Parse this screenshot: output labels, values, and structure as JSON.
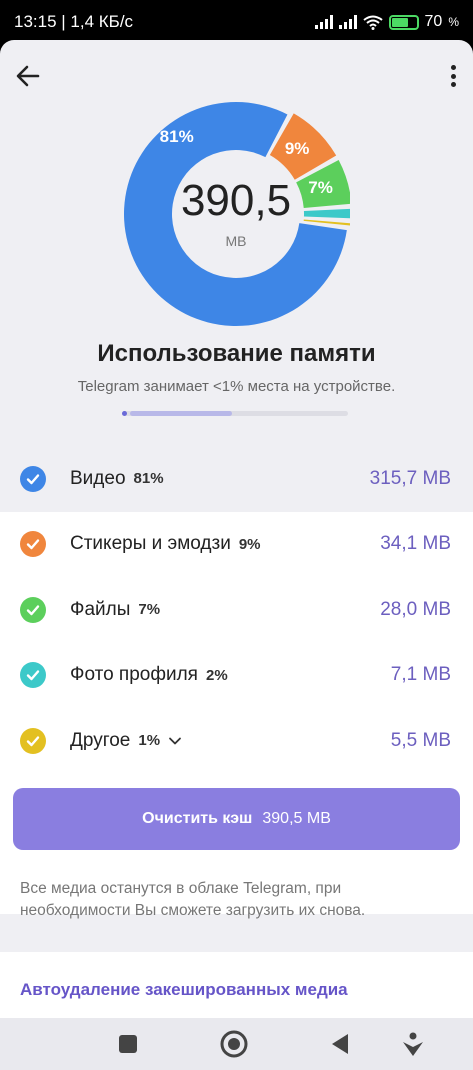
{
  "status": {
    "time_speed": "13:15 | 1,4 КБ/с",
    "battery": "70"
  },
  "chart_data": {
    "type": "pie",
    "total": "390,5",
    "unit": "MB",
    "categories": [
      "Видео",
      "Стикеры и эмодзи",
      "Файлы",
      "Фото профиля",
      "Другое"
    ],
    "values": [
      81,
      9,
      7,
      2,
      1
    ],
    "colors": [
      "#3e86e6",
      "#f0863d",
      "#5ccf5c",
      "#3cc9c9",
      "#e3c021"
    ],
    "labels": [
      "81%",
      "9%",
      "7%",
      "",
      ""
    ]
  },
  "header": {
    "title": "Использование памяти",
    "subtitle": "Telegram занимает <1% места на устройстве."
  },
  "items": [
    {
      "label": "Видео",
      "pct": "81%",
      "size": "315,7 MB",
      "color": "#3e86e6"
    },
    {
      "label": "Стикеры и эмодзи",
      "pct": "9%",
      "size": "34,1 MB",
      "color": "#f0863d"
    },
    {
      "label": "Файлы",
      "pct": "7%",
      "size": "28,0 MB",
      "color": "#5ccf5c"
    },
    {
      "label": "Фото профиля",
      "pct": "2%",
      "size": "7,1 MB",
      "color": "#3cc9c9"
    },
    {
      "label": "Другое",
      "pct": "1%",
      "size": "5,5 MB",
      "color": "#e3c021"
    }
  ],
  "clear_button": {
    "label": "Очистить кэш",
    "size": "390,5 MB"
  },
  "note": "Все медиа останутся в облаке Telegram, при необходимости Вы сможете загрузить их снова.",
  "auto_delete": "Автоудаление закешированных медиа",
  "accent": "#8a7ee0"
}
